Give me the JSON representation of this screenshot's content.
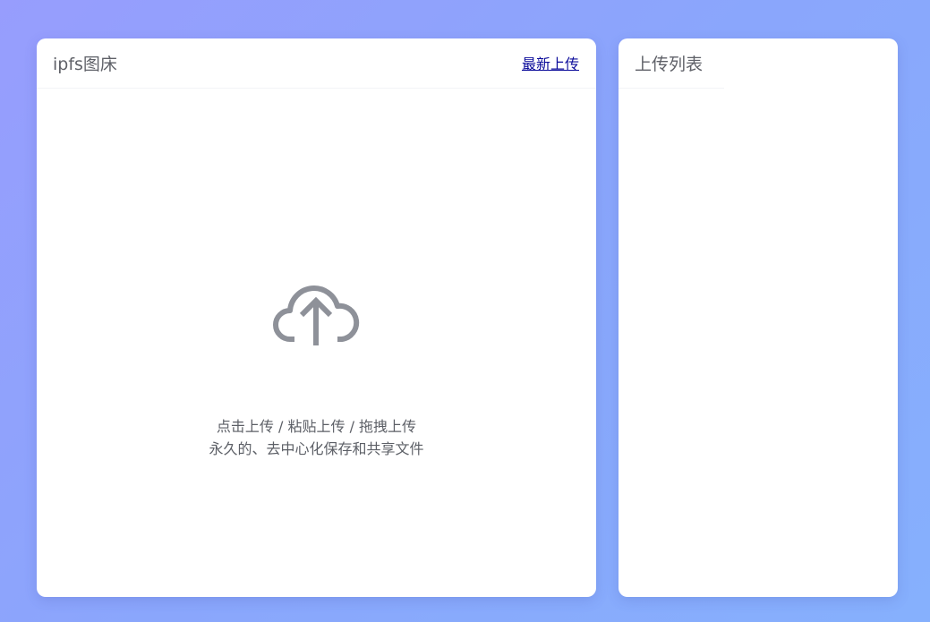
{
  "main_card": {
    "title": "ipfs图床",
    "latest_link": "最新上传",
    "upload": {
      "icon": "cloud-upload-icon",
      "hint": "点击上传 / 粘贴上传 / 拖拽上传",
      "description": "永久的、去中心化保存和共享文件"
    }
  },
  "side_card": {
    "title": "上传列表",
    "items": []
  },
  "colors": {
    "background_start": "#979dfd",
    "background_end": "#86b0fd",
    "card": "#ffffff",
    "title_text": "#5f6168",
    "link": "#0b0b9a",
    "icon": "#8e9199"
  }
}
